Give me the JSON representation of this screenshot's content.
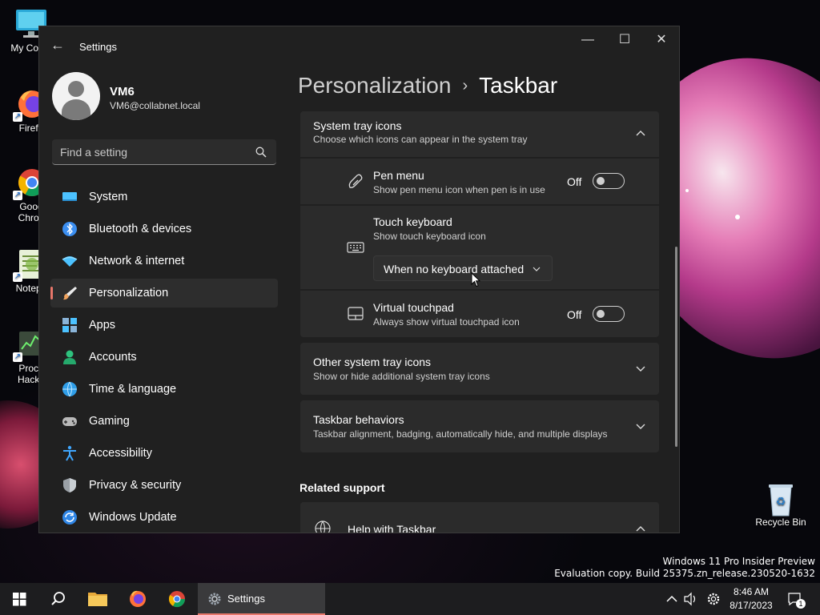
{
  "desktop": {
    "icons": [
      {
        "label": "My Comp"
      },
      {
        "label": "Firefo"
      },
      {
        "label": "Goog\nChron"
      },
      {
        "label": "Notepa"
      },
      {
        "label": "Proce\nHacke"
      },
      {
        "label": "Recycle Bin"
      }
    ],
    "watermark_line1": "Windows 11 Pro Insider Preview",
    "watermark_line2": "Evaluation copy. Build 25375.zn_release.230520-1632"
  },
  "window": {
    "title": "Settings",
    "back_glyph": "←",
    "minimize_glyph": "—",
    "maximize_glyph": "☐",
    "close_glyph": "✕"
  },
  "profile": {
    "name": "VM6",
    "email": "VM6@collabnet.local"
  },
  "search": {
    "placeholder": "Find a setting"
  },
  "nav": {
    "items": [
      {
        "label": "System"
      },
      {
        "label": "Bluetooth & devices"
      },
      {
        "label": "Network & internet"
      },
      {
        "label": "Personalization"
      },
      {
        "label": "Apps"
      },
      {
        "label": "Accounts"
      },
      {
        "label": "Time & language"
      },
      {
        "label": "Gaming"
      },
      {
        "label": "Accessibility"
      },
      {
        "label": "Privacy & security"
      },
      {
        "label": "Windows Update"
      }
    ],
    "active": "Personalization"
  },
  "breadcrumb": {
    "parent": "Personalization",
    "separator": "›",
    "current": "Taskbar"
  },
  "system_tray": {
    "title": "System tray icons",
    "subtitle": "Choose which icons can appear in the system tray",
    "pen_menu": {
      "title": "Pen menu",
      "subtitle": "Show pen menu icon when pen is in use",
      "state": "Off"
    },
    "touch_keyboard": {
      "title": "Touch keyboard",
      "subtitle": "Show touch keyboard icon",
      "dropdown_value": "When no keyboard attached"
    },
    "virtual_touchpad": {
      "title": "Virtual touchpad",
      "subtitle": "Always show virtual touchpad icon",
      "state": "Off"
    }
  },
  "other_tray": {
    "title": "Other system tray icons",
    "subtitle": "Show or hide additional system tray icons"
  },
  "behaviors": {
    "title": "Taskbar behaviors",
    "subtitle": "Taskbar alignment, badging, automatically hide, and multiple displays"
  },
  "related": {
    "heading": "Related support",
    "help_title": "Help with Taskbar"
  },
  "taskbar": {
    "active_app_label": "Settings",
    "time": "8:46 AM",
    "date": "8/17/2023",
    "notification_count": "1"
  },
  "colors": {
    "accent": "#e8776a",
    "window_bg": "#202020",
    "card_bg": "#2b2b2b"
  }
}
